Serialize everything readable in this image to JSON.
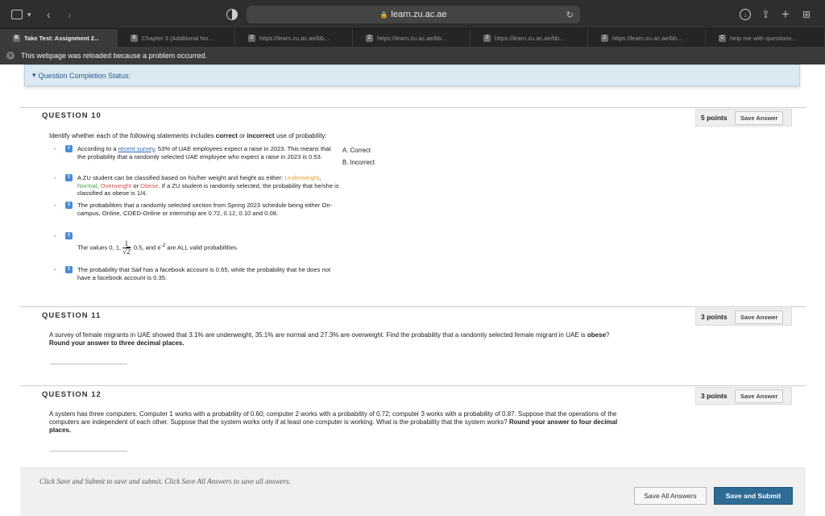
{
  "browser": {
    "url": "learn.zu.ac.ae",
    "tabs": [
      {
        "label": "Take Test: Assignment 2...",
        "active": true
      },
      {
        "label": "Chapter 3 (Additional No...",
        "active": false
      },
      {
        "label": "https://learn.zu.ac.ae/bb...",
        "active": false
      },
      {
        "label": "https://learn.zu.ac.ae/bb...",
        "active": false
      },
      {
        "label": "https://learn.zu.ac.ae/bb...",
        "active": false
      },
      {
        "label": "https://learn.zu.ac.ae/bb...",
        "active": false
      },
      {
        "label": "help me with questions...",
        "active": false
      }
    ],
    "reload_message": "This webpage was reloaded because a problem occurred."
  },
  "status_bar": {
    "label": "Question Completion Status:"
  },
  "questions": {
    "q10": {
      "title": "QUESTION 10",
      "points": "5 points",
      "save": "Save Answer",
      "prompt_a": "Identify whether each of the following statements includes ",
      "prompt_b": "correct",
      "prompt_c": " or ",
      "prompt_d": "incorrect",
      "prompt_e": " use of probability:",
      "options": [
        "A. Correct",
        "B. Incorrect"
      ],
      "s1_a": "According to a ",
      "s1_link": "recent survey",
      "s1_b": ", 53% of UAE employees expect a raise in 2023. This means that the probability that a randomly selected UAE employee who expect a raise in 2023 is 0.53.",
      "s2_a": "A ZU student can be classified based on his/her weight and height as either: ",
      "s2_under": "Underweight",
      "s2_normal": "Normal",
      "s2_over": "Overweight",
      "s2_or": "or",
      "s2_obese": "Obese",
      "s2_b": ". If a ZU student is randomly selected, the probability that he/she is classified as obese is 1/4.",
      "s3": "The probabilities that a randomly selected section from Spring 2023 schedule being either On-campus, Online, COED-Online or internship are 0.72, 0.12, 0.10 and 0.08.",
      "s4_a": "The values 0, 1, ",
      "s4_frac_num": "1",
      "s4_frac_den": "2",
      "s4_b": ", 0.5, and e",
      "s4_exp": "-2",
      "s4_c": " are ALL valid probabilities.",
      "s5": "The probability that Saif has a facebook account is 0.65, while the probability that he does not have a facebook account is 0.35."
    },
    "q11": {
      "title": "QUESTION 11",
      "points": "3 points",
      "save": "Save Answer",
      "text_a": "A survey of female migrants in UAE showed that 3.1% are underweight, 35.1% are normal and 27.3% are overweight. Find the probability that a randomly selected female migrant in UAE is ",
      "text_b": "obese",
      "text_c": "? ",
      "text_d": "Round your answer to three decimal places."
    },
    "q12": {
      "title": "QUESTION 12",
      "points": "3 points",
      "save": "Save Answer",
      "text_a": "A system has three computers. Computer 1 works with a probability of 0.60; computer 2 works with a probability of 0.72; computer 3 works with a probability of 0.87. Suppose that the operations of the computers are independent of each other. Suppose that the system works only if at least one computer is working. What is the probability that the system works? ",
      "text_b": "Round your answer to four decimal places."
    }
  },
  "footer": {
    "note": "Click Save and Submit to save and submit. Click Save All Answers to save all answers.",
    "save_all": "Save All Answers",
    "save_submit": "Save and Submit"
  },
  "colors": {
    "accent": "#2e6b95",
    "link": "#2a6ab8",
    "underweight": "#e8a33b",
    "normal": "#4aa84a",
    "overweight": "#d9534f",
    "obese": "#d9534f"
  }
}
